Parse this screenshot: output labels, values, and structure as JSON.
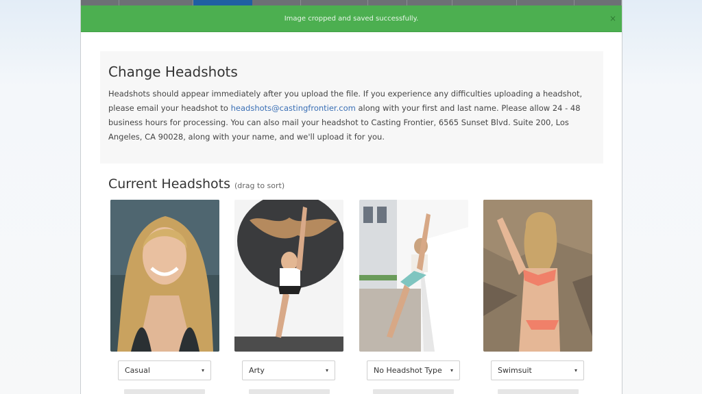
{
  "alert": {
    "message": "Image cropped and saved successfully.",
    "close": "×"
  },
  "info": {
    "title": "Change Headshots",
    "text_1": "Headshots should appear immediately after you upload the file. If you experience any difficulties uploading a headshot, please email your headshot to ",
    "email": "headshots@castingfrontier.com",
    "text_2": " along with your first and last name. Please allow 24 - 48 business hours for processing. You can also mail your headshot to Casting Frontier, 6565 Sunset Blvd. Suite 200, Los Angeles, CA 90028, along with your name, and we'll upload it for you."
  },
  "current": {
    "title": "Current Headshots",
    "hint": "(drag to sort)"
  },
  "headshots": [
    {
      "type": "Casual"
    },
    {
      "type": "Arty"
    },
    {
      "type": "No Headshot Type"
    },
    {
      "type": "Swimsuit"
    }
  ],
  "icons": {
    "caret": "▾"
  },
  "colors": {
    "alert_bg": "#4caf50",
    "nav_active": "#1f5fa3",
    "link": "#3a6fb5"
  }
}
